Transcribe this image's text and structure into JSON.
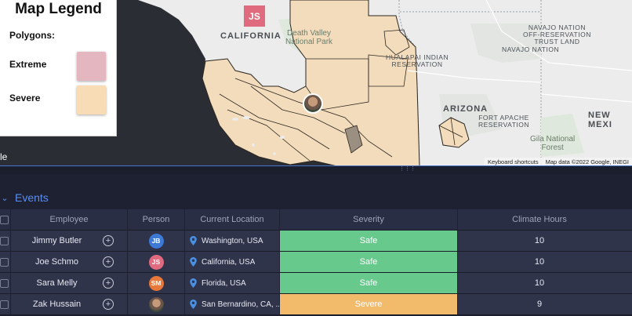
{
  "legend": {
    "title": "Map Legend",
    "subtitle": "Polygons:",
    "items": [
      {
        "label": "Extreme",
        "color": "#e3b6c0"
      },
      {
        "label": "Severe",
        "color": "#f8dcb5"
      }
    ]
  },
  "map": {
    "labels": {
      "california": "CALIFORNIA",
      "arizona": "ARIZONA",
      "new_mexico": "NEW MEXI",
      "navajo_nation": "NAVAJO NATION",
      "navajo_off": "NAVAJO NATION\nOFF-RESERVATION\nTRUST LAND",
      "hualapai": "HUALAPAI INDIAN\nRESERVATION",
      "fort_apache": "FORT APACHE\nRESERVATION",
      "death_valley": "Death Valley\nNational Park",
      "gila": "Gila National\nForest"
    },
    "map_avatar_initials": "JS",
    "edge_text": "le",
    "footer": {
      "shortcuts": "Keyboard shortcuts",
      "attribution": "Map data ©2022 Google, INEGI"
    },
    "colors": {
      "water": "#2a2d33",
      "land": "#ececec",
      "overlay": "#f3dcbc",
      "overlay_stroke": "#2b2620"
    }
  },
  "events": {
    "title": "Events",
    "columns": [
      "Employee",
      "Person",
      "Current Location",
      "Severity",
      "Climate Hours"
    ],
    "rows": [
      {
        "employee": "Jimmy Butler",
        "initials": "JB",
        "avatar_color": "#3d7ad6",
        "location": "Washington, USA",
        "severity": "Safe",
        "severity_color": "#67ca8c",
        "hours": "10"
      },
      {
        "employee": "Joe Schmo",
        "initials": "JS",
        "avatar_color": "#e06b7f",
        "location": "California, USA",
        "severity": "Safe",
        "severity_color": "#67ca8c",
        "hours": "10"
      },
      {
        "employee": "Sara Melly",
        "initials": "SM",
        "avatar_color": "#e8773a",
        "location": "Florida, USA",
        "severity": "Safe",
        "severity_color": "#67ca8c",
        "hours": "10"
      },
      {
        "employee": "Zak Hussain",
        "initials": "",
        "avatar_color": "",
        "location": "San Bernardino, CA, ...",
        "severity": "Severe",
        "severity_color": "#f2bb6c",
        "hours": "9"
      }
    ]
  }
}
